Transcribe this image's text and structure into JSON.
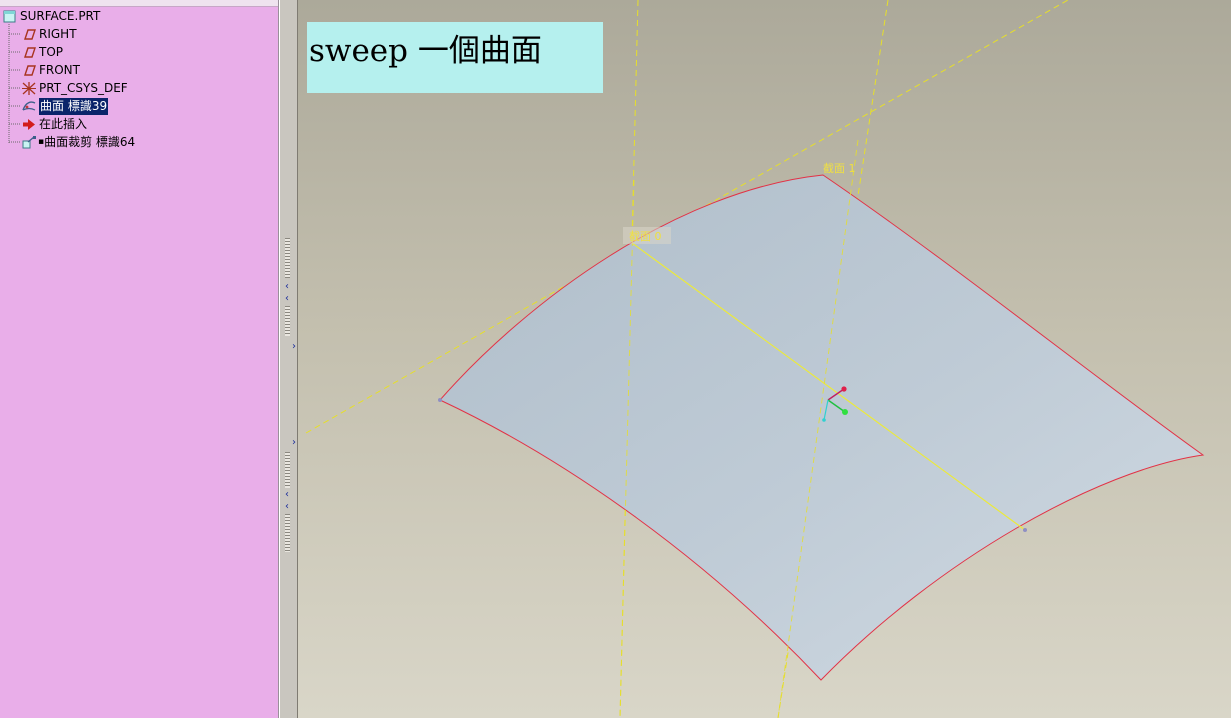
{
  "model_tree": {
    "items": [
      {
        "label": "SURFACE.PRT",
        "icon": "part-icon"
      },
      {
        "label": "RIGHT",
        "icon": "datum-plane-icon"
      },
      {
        "label": "TOP",
        "icon": "datum-plane-icon"
      },
      {
        "label": "FRONT",
        "icon": "datum-plane-icon"
      },
      {
        "label": "PRT_CSYS_DEF",
        "icon": "coordinate-system-icon"
      },
      {
        "label": "曲面 標識39",
        "icon": "surface-feature-icon",
        "selected": true
      },
      {
        "label": "在此插入",
        "icon": "insert-here-arrow-icon"
      },
      {
        "label": "曲面裁剪 標識64",
        "icon": "surface-trim-icon"
      }
    ]
  },
  "viewport": {
    "caption": "sweep 一個曲面",
    "section_labels": {
      "section_0": "截面 0",
      "section_1": "截面 1"
    },
    "colors": {
      "surface_fill": "#b9c7d3",
      "surface_edge": "#e23246",
      "datum_lines": "#e6df2a",
      "trajectory": "#ecea3a",
      "caption_bg": "#b5f0ee",
      "tree_bg": "#e9aee9"
    }
  }
}
